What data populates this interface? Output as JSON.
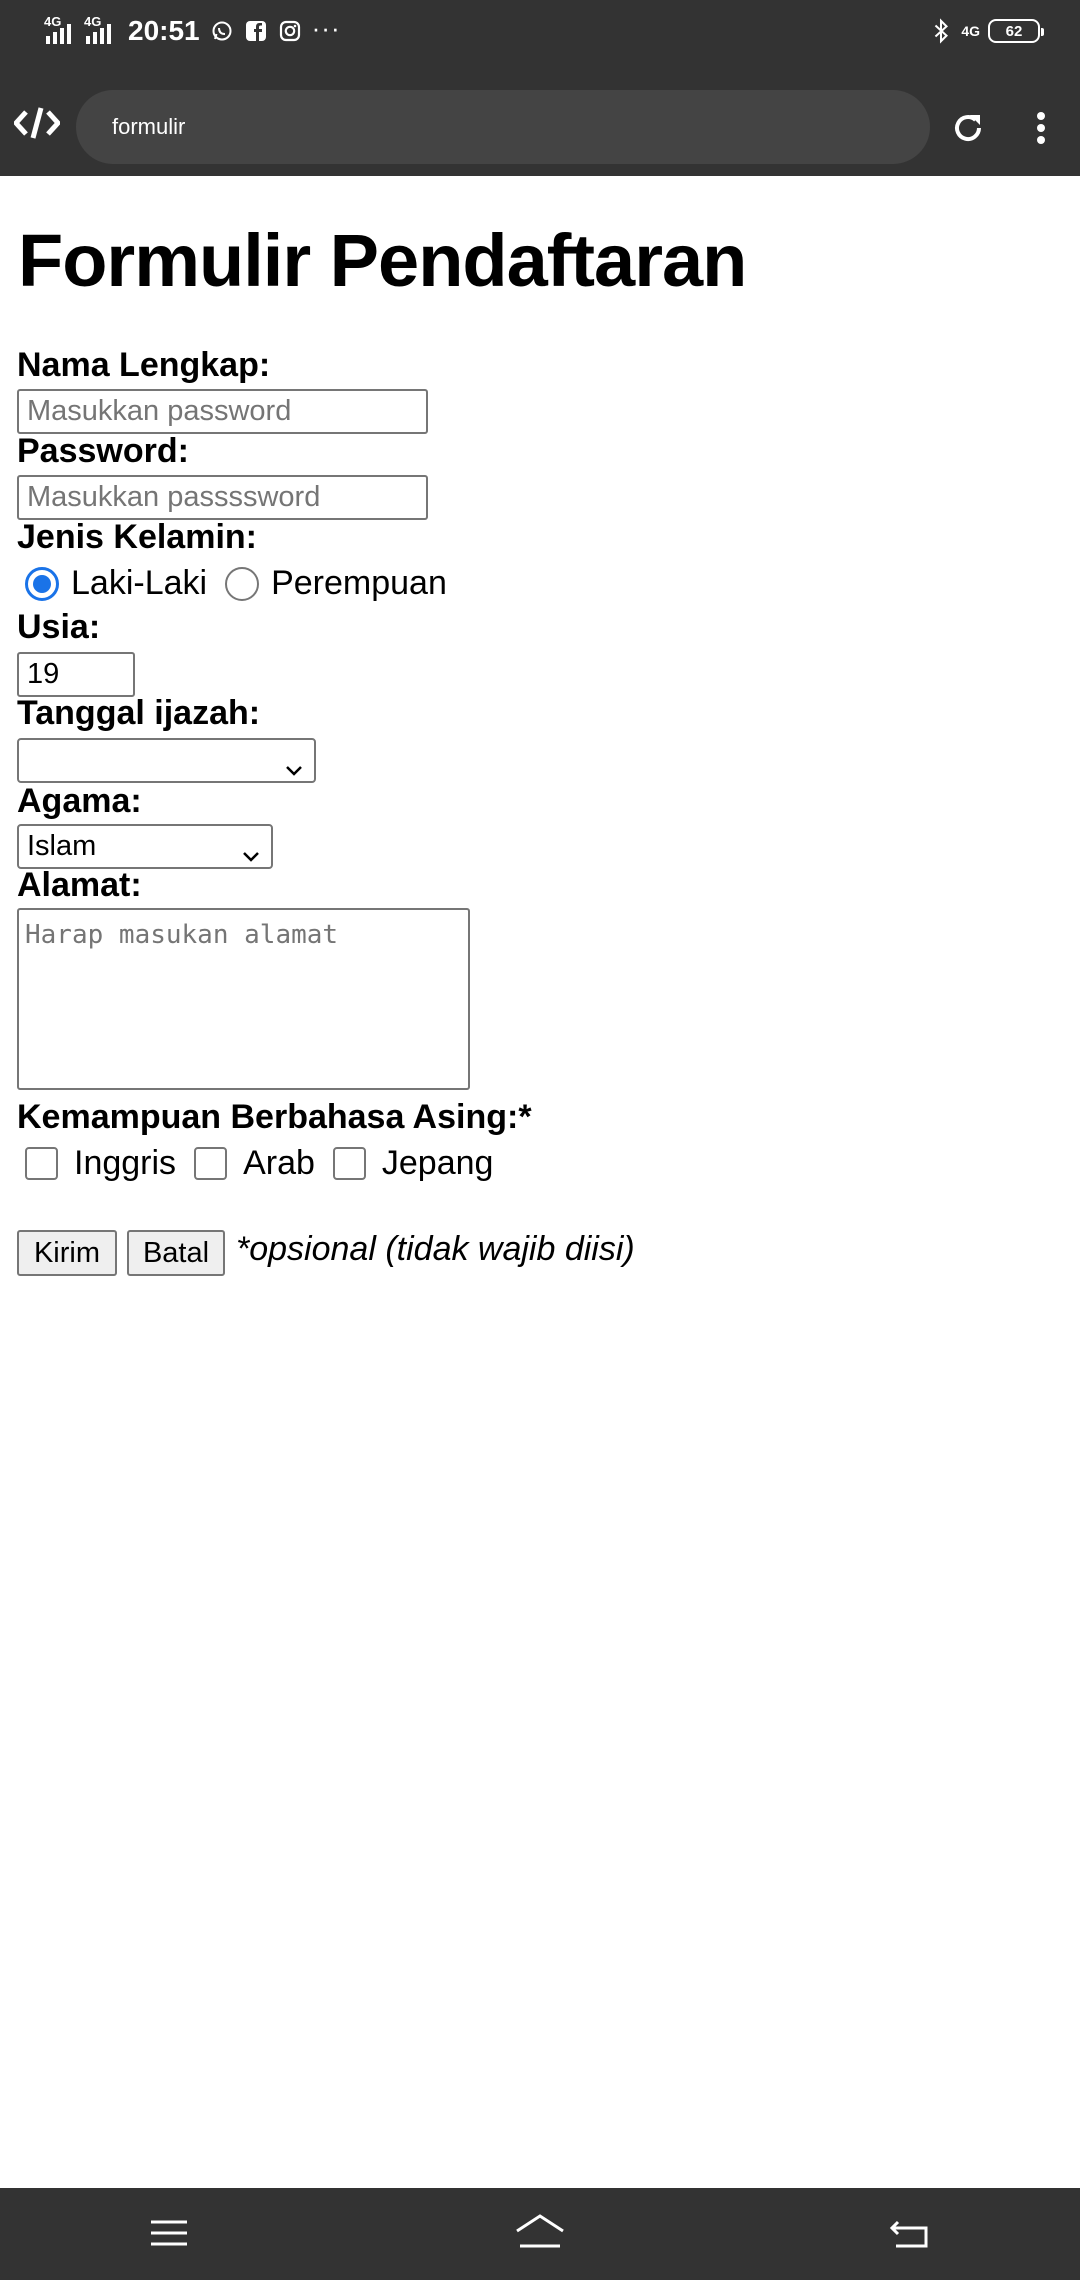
{
  "status_bar": {
    "signal_1": "4G",
    "signal_2": "4G",
    "time": "20:51",
    "notif_icons": [
      "whatsapp-icon",
      "facebook-icon",
      "instagram-icon"
    ],
    "more": "···",
    "net": "4G",
    "battery": "62"
  },
  "browser": {
    "url": "formulir"
  },
  "form": {
    "title": "Formulir Pendaftaran",
    "nama_label": "Nama Lengkap:",
    "nama_placeholder": "Masukkan password",
    "password_label": "Password:",
    "password_placeholder": "Masukkan passssword",
    "gender_label": "Jenis Kelamin:",
    "gender_options": [
      {
        "label": "Laki-Laki",
        "selected": true
      },
      {
        "label": "Perempuan",
        "selected": false
      }
    ],
    "usia_label": "Usia:",
    "usia_value": "19",
    "tanggal_label": "Tanggal ijazah:",
    "tanggal_value": "",
    "agama_label": "Agama:",
    "agama_value": "Islam",
    "alamat_label": "Alamat:",
    "alamat_placeholder": "Harap masukan alamat",
    "bahasa_label": "Kemampuan Berbahasa Asing:*",
    "bahasa_options": [
      {
        "label": "Inggris",
        "checked": false
      },
      {
        "label": "Arab",
        "checked": false
      },
      {
        "label": "Jepang",
        "checked": false
      }
    ],
    "submit_label": "Kirim",
    "cancel_label": "Batal",
    "note": "*opsional (tidak wajib diisi)"
  },
  "colors": {
    "chrome": "#333333",
    "accent": "#1a73e8"
  }
}
